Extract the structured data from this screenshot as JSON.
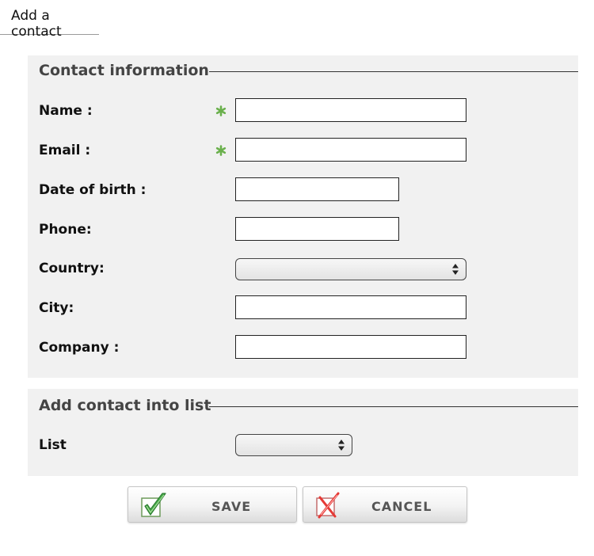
{
  "page": {
    "title": "Add a contact"
  },
  "contact_section": {
    "legend": "Contact information",
    "fields": {
      "name": {
        "label": "Name :",
        "value": "",
        "required": true
      },
      "email": {
        "label": "Email :",
        "value": "",
        "required": true
      },
      "birth_date": {
        "label": "Date of birth :",
        "value": ""
      },
      "phone": {
        "label": "Phone:",
        "value": ""
      },
      "country": {
        "label": "Country:",
        "selected": ""
      },
      "city": {
        "label": "City:",
        "value": ""
      },
      "company": {
        "label": "Company :",
        "value": ""
      }
    }
  },
  "list_section": {
    "legend": "Add contact into list",
    "list_field": {
      "label": "List",
      "selected": ""
    }
  },
  "actions": {
    "save_label": "SAVE",
    "cancel_label": "CANCEL"
  },
  "icons": {
    "required": "asterisk-icon",
    "select": "updown-arrows-icon",
    "save": "checkmark-icon",
    "cancel": "cross-icon"
  },
  "colors": {
    "panel_bg": "#f1f1f1",
    "required": "#6ab04c",
    "save_check": "#4caf50",
    "cancel_cross": "#e53935"
  }
}
